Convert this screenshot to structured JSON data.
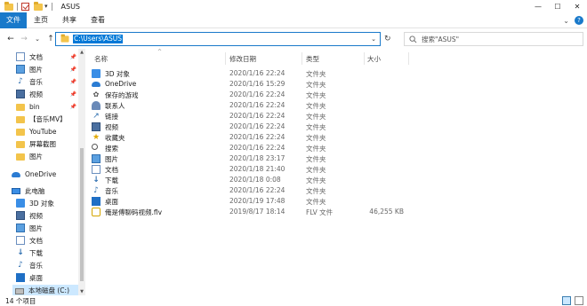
{
  "window": {
    "title": "ASUS",
    "quick_access_dropdown": "▾",
    "minimize": "—",
    "maximize": "☐",
    "close": "✕"
  },
  "ribbon": {
    "tabs": [
      "文件",
      "主页",
      "共享",
      "查看"
    ],
    "expand": "⌄",
    "help": "?"
  },
  "nav": {
    "back": "←",
    "forward": "→",
    "recent": "⌄",
    "up": "↑",
    "address": "C:\\Users\\ASUS",
    "address_dropdown": "⌄",
    "refresh": "↻",
    "search_placeholder": "搜索\"ASUS\""
  },
  "sidebar": {
    "items": [
      {
        "label": "文档",
        "icon": "document-icon",
        "pinned": true
      },
      {
        "label": "图片",
        "icon": "picture-icon",
        "pinned": true
      },
      {
        "label": "音乐",
        "icon": "music-icon",
        "pinned": true
      },
      {
        "label": "视频",
        "icon": "video-icon",
        "pinned": true
      },
      {
        "label": "bin",
        "icon": "folder-icon",
        "pinned": true
      },
      {
        "label": "【音乐MV】",
        "icon": "folder-icon",
        "pinned": false
      },
      {
        "label": "YouTube",
        "icon": "folder-icon",
        "pinned": false
      },
      {
        "label": "屏幕截图",
        "icon": "folder-icon",
        "pinned": false
      },
      {
        "label": "图片",
        "icon": "folder-icon",
        "pinned": false
      },
      {
        "label": "OneDrive",
        "icon": "onedrive-icon",
        "pinned": false
      },
      {
        "label": "此电脑",
        "icon": "this-pc-icon",
        "pinned": false
      },
      {
        "label": "3D 对象",
        "icon": "3d-objects-icon",
        "pinned": false
      },
      {
        "label": "视频",
        "icon": "video-icon",
        "pinned": false
      },
      {
        "label": "图片",
        "icon": "picture-icon",
        "pinned": false
      },
      {
        "label": "文档",
        "icon": "document-icon",
        "pinned": false
      },
      {
        "label": "下载",
        "icon": "download-icon",
        "pinned": false
      },
      {
        "label": "音乐",
        "icon": "music-icon",
        "pinned": false
      },
      {
        "label": "桌面",
        "icon": "desktop-icon",
        "pinned": false
      },
      {
        "label": "本地磁盘 (C:)",
        "icon": "drive-icon",
        "pinned": false
      }
    ],
    "pin_glyph": "📌",
    "scroll_up": "▲",
    "scroll_down": "▼"
  },
  "columns": {
    "name": "名称",
    "date": "修改日期",
    "type": "类型",
    "size": "大小",
    "sort_caret": "^"
  },
  "files": [
    {
      "name": "3D 对象",
      "date": "2020/1/16 22:24",
      "type": "文件夹",
      "size": "",
      "icon": "3d-objects-icon"
    },
    {
      "name": "OneDrive",
      "date": "2020/1/16 15:29",
      "type": "文件夹",
      "size": "",
      "icon": "onedrive-icon"
    },
    {
      "name": "保存的游戏",
      "date": "2020/1/16 22:24",
      "type": "文件夹",
      "size": "",
      "icon": "saved-games-icon"
    },
    {
      "name": "联系人",
      "date": "2020/1/16 22:24",
      "type": "文件夹",
      "size": "",
      "icon": "contacts-icon"
    },
    {
      "name": "链接",
      "date": "2020/1/16 22:24",
      "type": "文件夹",
      "size": "",
      "icon": "links-icon"
    },
    {
      "name": "视频",
      "date": "2020/1/16 22:24",
      "type": "文件夹",
      "size": "",
      "icon": "video-icon"
    },
    {
      "name": "收藏夹",
      "date": "2020/1/16 22:24",
      "type": "文件夹",
      "size": "",
      "icon": "favorites-icon"
    },
    {
      "name": "搜索",
      "date": "2020/1/16 22:24",
      "type": "文件夹",
      "size": "",
      "icon": "searches-icon"
    },
    {
      "name": "图片",
      "date": "2020/1/18 23:17",
      "type": "文件夹",
      "size": "",
      "icon": "picture-icon"
    },
    {
      "name": "文档",
      "date": "2020/1/18 21:40",
      "type": "文件夹",
      "size": "",
      "icon": "document-icon"
    },
    {
      "name": "下载",
      "date": "2020/1/18 0:08",
      "type": "文件夹",
      "size": "",
      "icon": "download-icon"
    },
    {
      "name": "音乐",
      "date": "2020/1/16 22:24",
      "type": "文件夹",
      "size": "",
      "icon": "music-icon"
    },
    {
      "name": "桌面",
      "date": "2020/1/19 17:48",
      "type": "文件夹",
      "size": "",
      "icon": "desktop-icon"
    },
    {
      "name": "俺是傅聊码视频.flv",
      "date": "2019/8/17 18:14",
      "type": "FLV 文件",
      "size": "46,255 KB",
      "icon": "flv-file-icon"
    }
  ],
  "status": {
    "count": "14 个项目"
  },
  "colors": {
    "accent": "#1979ca",
    "selection": "#cce8ff",
    "folder": "#f3c44b"
  }
}
